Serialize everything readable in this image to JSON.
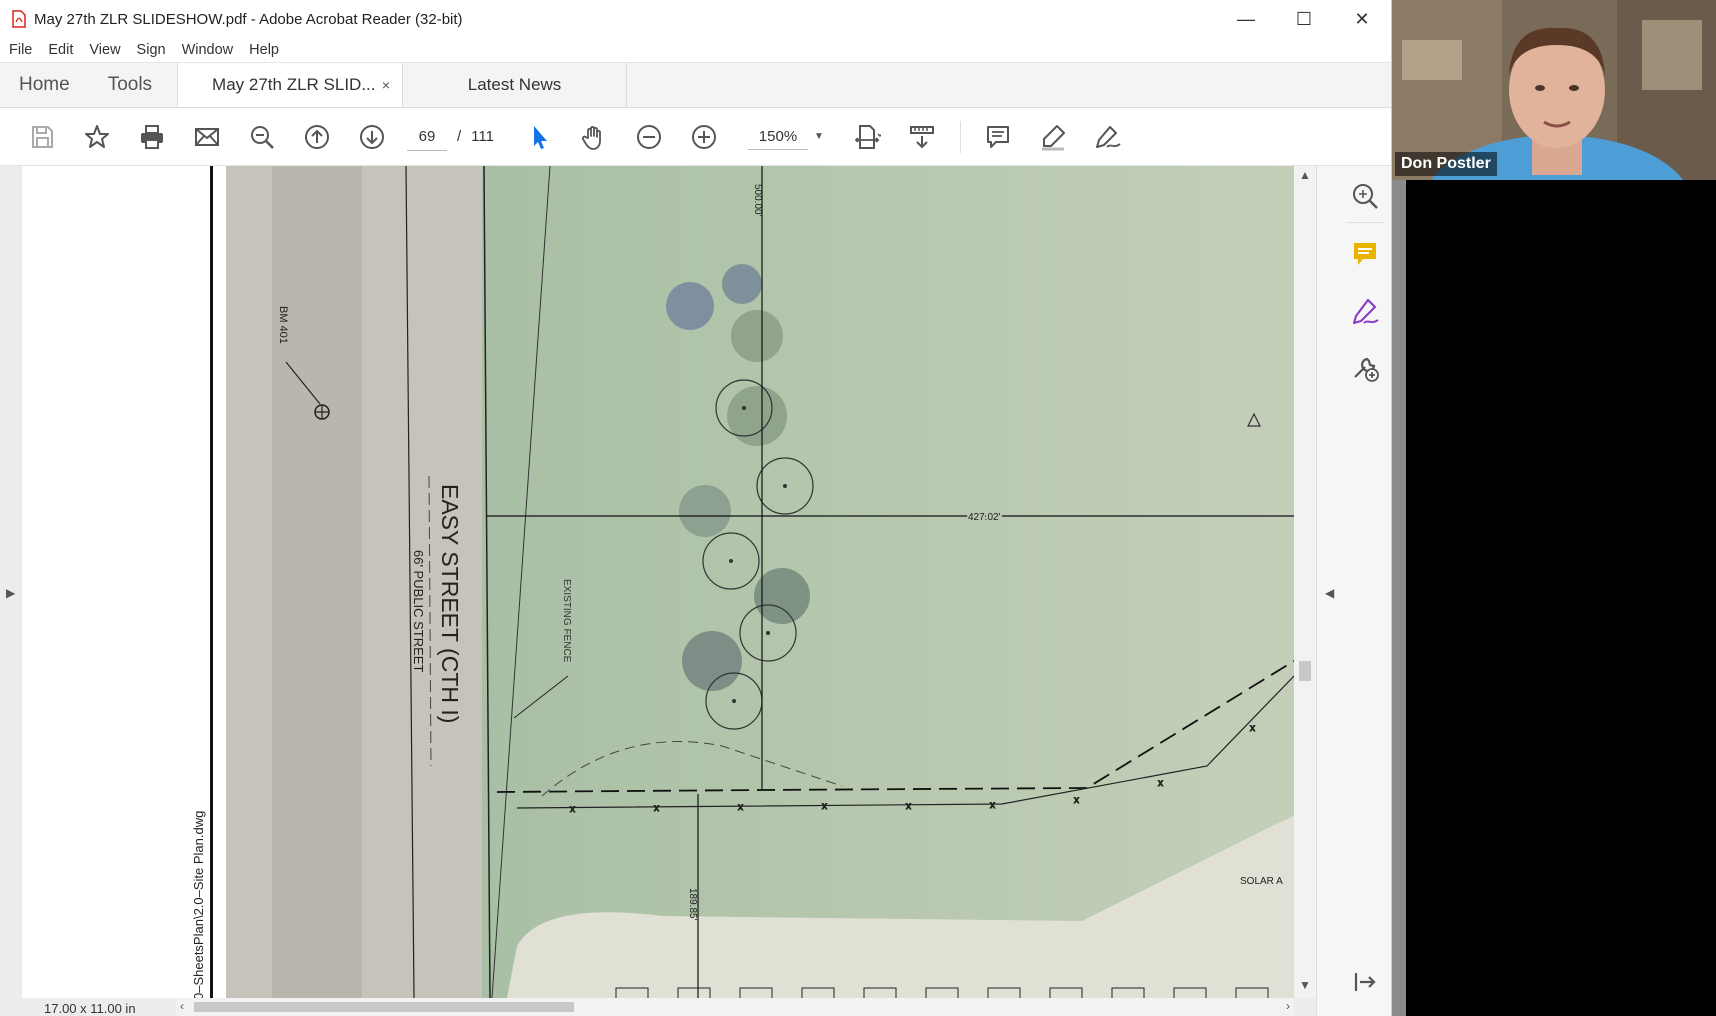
{
  "window": {
    "title": "May 27th ZLR SLIDESHOW.pdf - Adobe Acrobat Reader (32-bit)",
    "minimize": "—",
    "maximize": "☐",
    "close": "✕"
  },
  "menu": [
    "File",
    "Edit",
    "View",
    "Sign",
    "Window",
    "Help"
  ],
  "tabs": {
    "home": "Home",
    "tools": "Tools",
    "document": "May 27th ZLR SLID...",
    "document_close": "×",
    "news": "Latest News"
  },
  "toolbar": {
    "page_current": "69",
    "page_separator": "/",
    "page_total": "111",
    "zoom": "150%"
  },
  "drawing": {
    "bm_label": "BM 401",
    "street_name": "EASY STREET (CTH I)",
    "street_desc": "66' PUBLIC STREET",
    "dim_vertical_top": "500.00'",
    "dim_horizontal": "427.02'",
    "fence_label": "EXISTING FENCE",
    "dim_vertical_bottom": "189.85'",
    "solar_label": "SOLAR A",
    "file_path": "0–SheetsPlan\\2.0–Site Plan.dwg"
  },
  "status": {
    "page_size": "17.00 x 11.00 in"
  },
  "webcam": {
    "participant_name": "Don Postler"
  },
  "colors": {
    "acrobat_red": "#d9261c",
    "select_blue": "#1473e6",
    "comment_yellow": "#e8b400",
    "sign_purple": "#8b3fc9"
  }
}
